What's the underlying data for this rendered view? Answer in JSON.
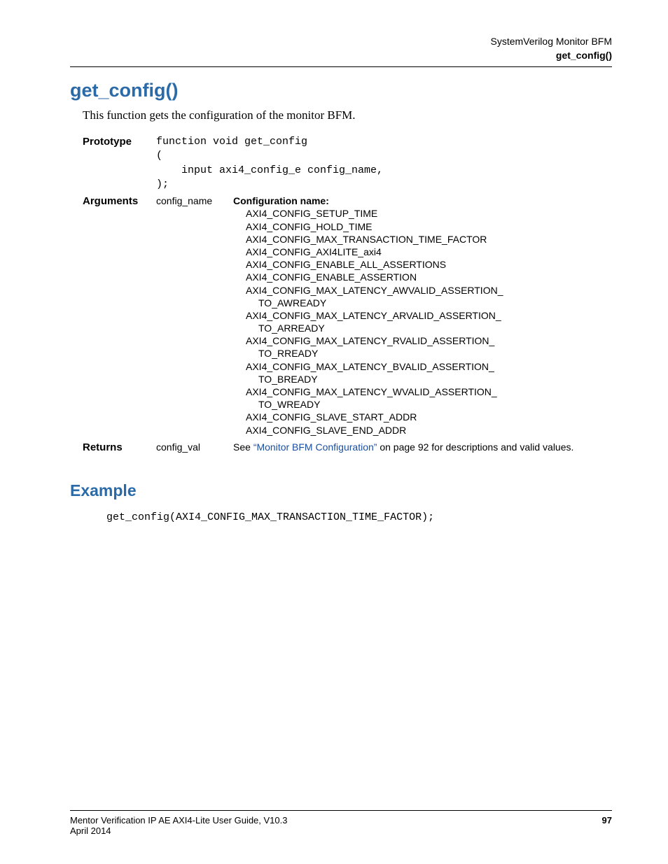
{
  "header": {
    "line1": "SystemVerilog Monitor BFM",
    "line2": "get_config()"
  },
  "title": "get_config()",
  "intro": "This function gets the configuration of the monitor BFM.",
  "sections": {
    "prototype_label": "Prototype",
    "prototype_code": "function void get_config\n(\n    input axi4_config_e config_name,\n);",
    "arguments_label": "Arguments",
    "arguments_sublabel": "config_name",
    "config_name_heading": "Configuration name:",
    "config_items": [
      {
        "text": "AXI4_CONFIG_SETUP_TIME"
      },
      {
        "text": "AXI4_CONFIG_HOLD_TIME"
      },
      {
        "text": "AXI4_CONFIG_MAX_TRANSACTION_TIME_FACTOR"
      },
      {
        "text": "AXI4_CONFIG_AXI4LITE_axi4"
      },
      {
        "text": "AXI4_CONFIG_ENABLE_ALL_ASSERTIONS"
      },
      {
        "text": "AXI4_CONFIG_ENABLE_ASSERTION"
      },
      {
        "text": "AXI4_CONFIG_MAX_LATENCY_AWVALID_ASSERTION_"
      },
      {
        "text": "TO_AWREADY",
        "sub": true
      },
      {
        "text": "AXI4_CONFIG_MAX_LATENCY_ARVALID_ASSERTION_"
      },
      {
        "text": "TO_ARREADY",
        "sub": true
      },
      {
        "text": "AXI4_CONFIG_MAX_LATENCY_RVALID_ASSERTION_"
      },
      {
        "text": "TO_RREADY",
        "sub": true
      },
      {
        "text": "AXI4_CONFIG_MAX_LATENCY_BVALID_ASSERTION_"
      },
      {
        "text": "TO_BREADY",
        "sub": true
      },
      {
        "text": "AXI4_CONFIG_MAX_LATENCY_WVALID_ASSERTION_"
      },
      {
        "text": "TO_WREADY",
        "sub": true
      },
      {
        "text": "AXI4_CONFIG_SLAVE_START_ADDR"
      },
      {
        "text": "AXI4_CONFIG_SLAVE_END_ADDR"
      }
    ],
    "returns_label": "Returns",
    "returns_sublabel": "config_val",
    "returns_prefix": "See ",
    "returns_link": "“Monitor BFM Configuration”",
    "returns_suffix": " on page 92 for descriptions and valid values."
  },
  "example": {
    "heading": "Example",
    "code": "get_config(AXI4_CONFIG_MAX_TRANSACTION_TIME_FACTOR);"
  },
  "footer": {
    "left": "Mentor Verification IP AE AXI4-Lite User Guide, V10.3",
    "right": "97",
    "date": "April 2014"
  }
}
